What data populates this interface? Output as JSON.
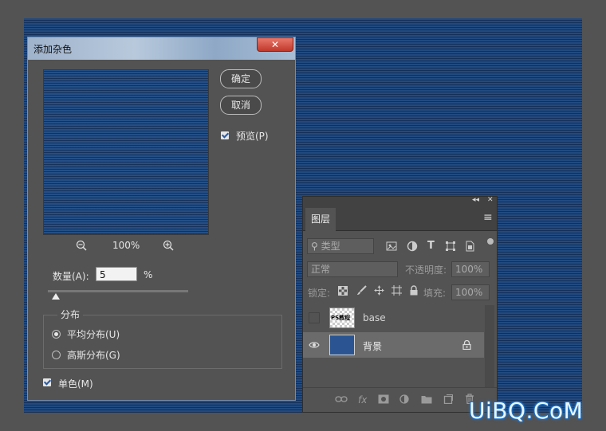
{
  "dialog": {
    "title": "添加杂色",
    "close_symbol": "✕",
    "ok_label": "确定",
    "cancel_label": "取消",
    "preview_label": "预览(P)",
    "preview_checked": true,
    "zoom_level": "100%",
    "amount_label": "数量(A):",
    "amount_value": "5",
    "amount_unit": "%",
    "distribution_title": "分布",
    "uniform_label": "平均分布(U)",
    "gaussian_label": "高斯分布(G)",
    "selected_distribution": "uniform",
    "monochrome_label": "单色(M)",
    "monochrome_checked": true
  },
  "layers_panel": {
    "tab_label": "图层",
    "collapse_symbol": "◂◂",
    "close_symbol": "✕",
    "menu_symbol": "≡",
    "filter_label": "类型",
    "blend_mode": "正常",
    "opacity_label": "不透明度:",
    "opacity_value": "100%",
    "lock_label": "锁定:",
    "fill_label": "填充:",
    "fill_value": "100%",
    "layers": [
      {
        "name": "base",
        "visible": false,
        "thumb_text": "PS教程"
      },
      {
        "name": "背景",
        "visible": true,
        "locked": true,
        "color": "#2a5592"
      }
    ]
  },
  "watermark": "UiBQ.CoM",
  "colors": {
    "canvas_blue": "#214a80",
    "dialog_bg": "#535353",
    "accent": "#2a5aa0"
  }
}
